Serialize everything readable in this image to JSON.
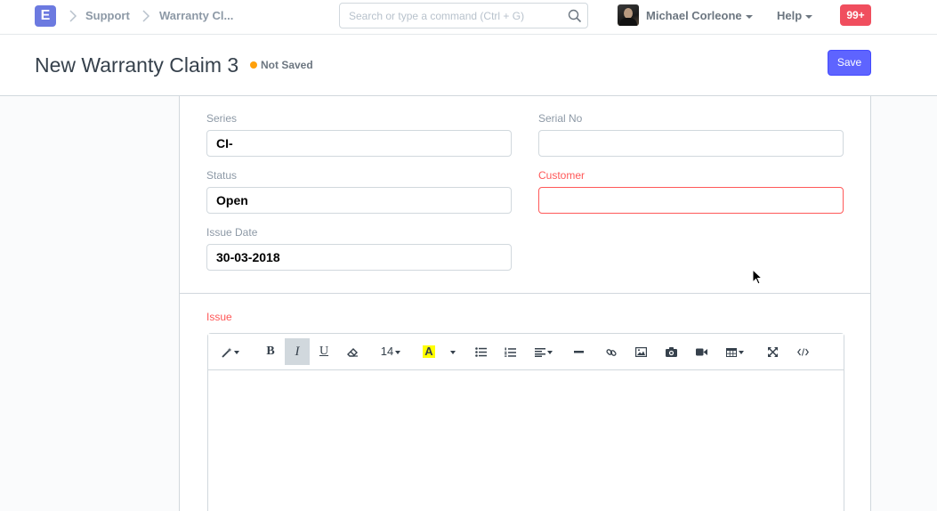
{
  "navbar": {
    "logo_letter": "E",
    "breadcrumbs": [
      "Support",
      "Warranty Cl..."
    ],
    "search_placeholder": "Search or type a command (Ctrl + G)",
    "user_name": "Michael Corleone",
    "help_label": "Help",
    "notifications_count": "99+"
  },
  "page": {
    "title": "New Warranty Claim 3",
    "status": "Not Saved",
    "save_label": "Save"
  },
  "form": {
    "series": {
      "label": "Series",
      "value": "CI-"
    },
    "serial_no": {
      "label": "Serial No",
      "value": ""
    },
    "status": {
      "label": "Status",
      "value": "Open"
    },
    "customer": {
      "label": "Customer",
      "value": ""
    },
    "issue_date": {
      "label": "Issue Date",
      "value": "30-03-2018"
    },
    "issue": {
      "label": "Issue",
      "font_size": "14"
    }
  },
  "colors": {
    "accent": "#5e64ff",
    "logo": "#6c7ae0",
    "required": "#ff5858",
    "notification": "#f04e5e",
    "status_dot": "#ffa00a"
  }
}
